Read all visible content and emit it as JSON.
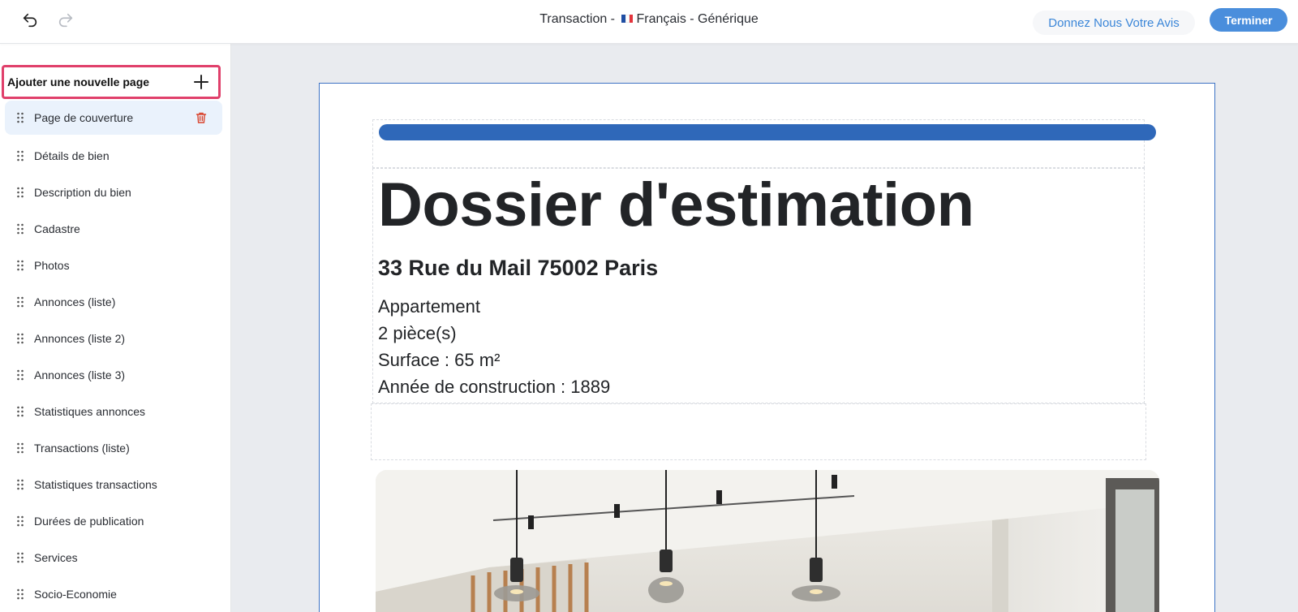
{
  "toolbar": {
    "title_prefix": "Transaction -",
    "flag_icon": "french-flag-icon",
    "title_language": "Français - Générique",
    "feedback_label": "Donnez Nous Votre Avis",
    "finish_label": "Terminer",
    "undo_icon": "undo-icon",
    "redo_icon": "redo-icon"
  },
  "sidebar": {
    "add_page_label": "Ajouter une nouvelle page",
    "add_icon": "plus-icon",
    "items": [
      {
        "label": "Page de couverture",
        "active": true
      },
      {
        "label": "Détails de bien"
      },
      {
        "label": "Description du bien"
      },
      {
        "label": "Cadastre"
      },
      {
        "label": "Photos"
      },
      {
        "label": "Annonces (liste)"
      },
      {
        "label": "Annonces (liste 2)"
      },
      {
        "label": "Annonces (liste 3)"
      },
      {
        "label": "Statistiques annonces"
      },
      {
        "label": "Transactions (liste)"
      },
      {
        "label": "Statistiques transactions"
      },
      {
        "label": "Durées de publication"
      },
      {
        "label": "Services"
      },
      {
        "label": "Socio-Economie"
      }
    ]
  },
  "document": {
    "heading": "Dossier d'estimation",
    "address": "33 Rue du Mail 75002 Paris",
    "property_type": "Appartement",
    "rooms": "2 pièce(s)",
    "surface": "Surface : 65 m²",
    "year": "Année de construction : 1889"
  },
  "colors": {
    "accent": "#4a8edc",
    "header_bar": "#2f68b9",
    "highlight": "#e0406b",
    "active_item_bg": "#eaf2fc",
    "trash": "#d9452e"
  }
}
